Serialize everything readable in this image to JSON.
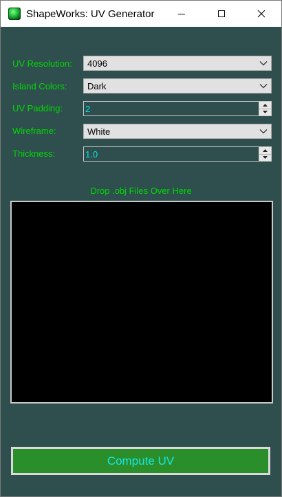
{
  "window": {
    "title": "ShapeWorks: UV Generator",
    "app_icon": "green-sphere-icon",
    "controls": [
      "minimize-icon",
      "maximize-icon",
      "close-icon"
    ]
  },
  "form": {
    "uv_resolution": {
      "label": "UV Resolution:",
      "value": "4096"
    },
    "island_colors": {
      "label": "Island Colors:",
      "value": "Dark"
    },
    "uv_padding": {
      "label": "UV Padding:",
      "value": "2"
    },
    "wireframe": {
      "label": "Wireframe:",
      "value": "White"
    },
    "thickness": {
      "label": "Thickness:",
      "value": "1.0"
    }
  },
  "drop": {
    "label": "Drop .obj Files Over Here"
  },
  "actions": {
    "compute_label": "Compute UV"
  },
  "colors": {
    "background": "#2f4f4f",
    "label_green": "#00d800",
    "value_cyan": "#00e5e5",
    "button_green": "#2a8f2a",
    "drop_area": "#000000"
  }
}
